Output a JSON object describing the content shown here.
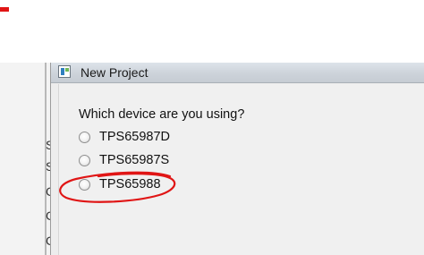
{
  "background_window": {
    "fragments": [
      "S",
      "S",
      "C",
      "C",
      "C"
    ]
  },
  "dialog": {
    "title": "New Project",
    "question": "Which device are you using?",
    "options": [
      {
        "label": "TPS65987D",
        "selected": false
      },
      {
        "label": "TPS65987S",
        "selected": false
      },
      {
        "label": "TPS65988",
        "selected": false
      }
    ]
  },
  "annotation": {
    "color": "#e01515",
    "circled_option": "TPS65988"
  }
}
